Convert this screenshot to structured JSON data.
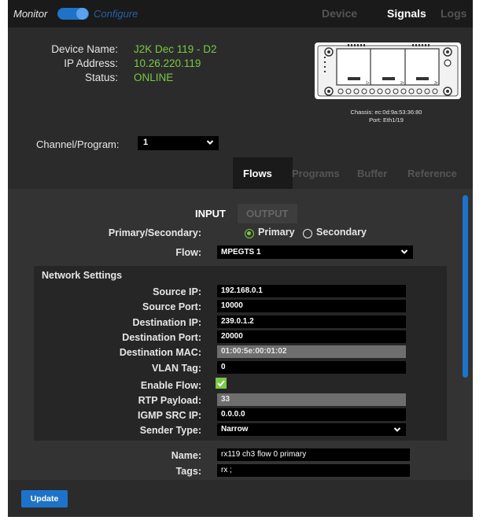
{
  "topbar": {
    "mode_monitor": "Monitor",
    "mode_configure": "Configure",
    "tabs": [
      "Device",
      "Signals",
      "Logs"
    ],
    "active_tab": "Signals"
  },
  "device": {
    "labels": [
      "Device Name:",
      "IP Address:",
      "Status:"
    ],
    "values": [
      "J2K Dec 119 - D2",
      "10.26.220.119",
      "ONLINE"
    ],
    "chassis": "Chassis: ec:0d:9a:53:36:80",
    "port": "Port: Eth1/19",
    "port_labels": [
      "1•",
      "2•",
      "3•"
    ]
  },
  "channel": {
    "label": "Channel/Program:",
    "value": "1"
  },
  "subtabs": {
    "items": [
      "Flows",
      "Programs",
      "Buffer",
      "Reference"
    ],
    "active": "Flows"
  },
  "io_tabs": {
    "input": "INPUT",
    "output": "OUTPUT",
    "active": "INPUT"
  },
  "primary_secondary": {
    "label": "Primary/Secondary:",
    "primary": "Primary",
    "secondary": "Secondary",
    "selected": "Primary"
  },
  "flow": {
    "label": "Flow:",
    "value": "MPEGTS 1"
  },
  "network": {
    "title": "Network Settings",
    "source_ip": {
      "label": "Source IP:",
      "value": "192.168.0.1"
    },
    "source_port": {
      "label": "Source Port:",
      "value": "10000"
    },
    "destination_ip": {
      "label": "Destination IP:",
      "value": "239.0.1.2"
    },
    "destination_port": {
      "label": "Destination Port:",
      "value": "20000"
    },
    "destination_mac": {
      "label": "Destination MAC:",
      "value": "01:00:5e:00:01:02"
    },
    "vlan_tag": {
      "label": "VLAN Tag:",
      "value": "0"
    },
    "enable_flow": {
      "label": "Enable Flow:",
      "checked": true
    },
    "rtp_payload": {
      "label": "RTP Payload:",
      "value": "33"
    },
    "igmp_src_ip": {
      "label": "IGMP SRC IP:",
      "value": "0.0.0.0"
    },
    "sender_type": {
      "label": "Sender Type:",
      "value": "Narrow"
    }
  },
  "meta": {
    "name": {
      "label": "Name:",
      "value": "rx119 ch3 flow 0 primary"
    },
    "tags": {
      "label": "Tags:",
      "value": "rx ;"
    }
  },
  "actions": {
    "update": "Update"
  },
  "colors": {
    "accent": "#1e73c8",
    "status_green": "#7ac943",
    "panel": "#333333",
    "background": "#2b2b2b"
  }
}
